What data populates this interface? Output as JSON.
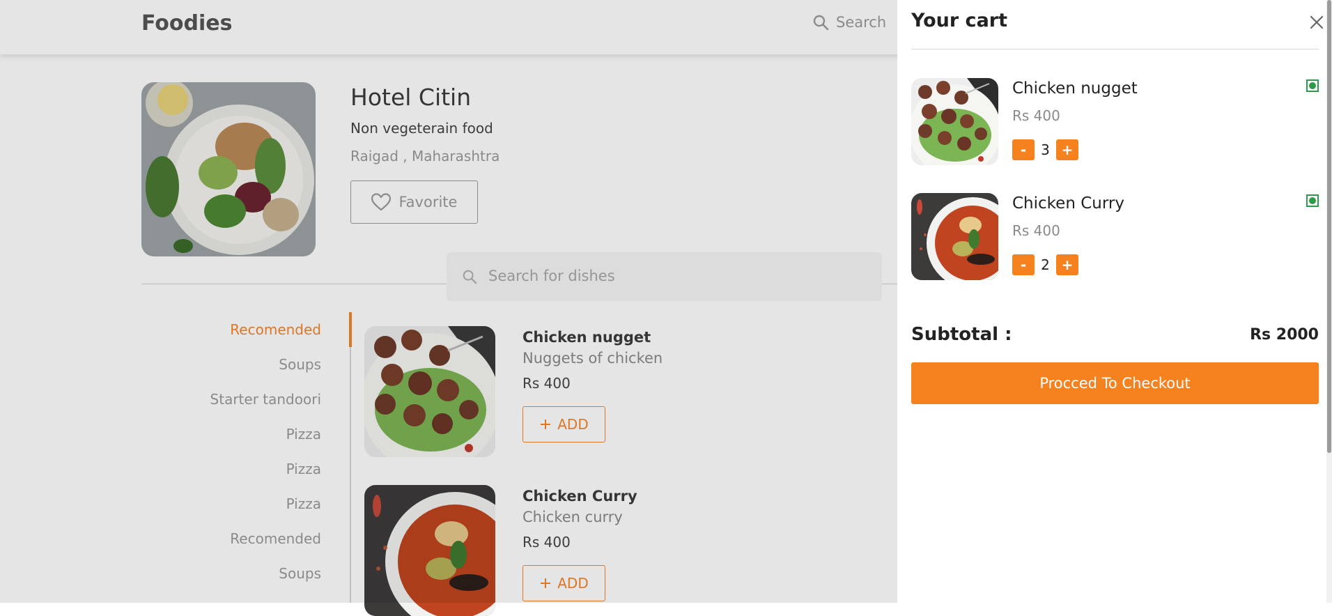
{
  "header": {
    "brand": "Foodies",
    "search_label": "Search"
  },
  "restaurant": {
    "name": "Hotel Citin",
    "type": "Non vegeterain food",
    "location": "Raigad , Maharashtra",
    "favorite_label": "Favorite"
  },
  "dish_search": {
    "placeholder": "Search for dishes"
  },
  "categories": [
    {
      "label": "Recomended",
      "active": true
    },
    {
      "label": "Soups"
    },
    {
      "label": "Starter tandoori"
    },
    {
      "label": "Pizza"
    },
    {
      "label": "Pizza"
    },
    {
      "label": "Pizza"
    },
    {
      "label": "Recomended"
    },
    {
      "label": "Soups"
    }
  ],
  "dishes": [
    {
      "name": "Chicken nugget",
      "description": "Nuggets of chicken",
      "price": "Rs 400",
      "add_label": "ADD"
    },
    {
      "name": "Chicken Curry",
      "description": "Chicken curry",
      "price": "Rs 400",
      "add_label": "ADD"
    }
  ],
  "cart": {
    "title": "Your cart",
    "items": [
      {
        "name": "Chicken nugget",
        "price": "Rs 400",
        "quantity": "3",
        "minus": "-",
        "plus": "+"
      },
      {
        "name": "Chicken Curry",
        "price": "Rs 400",
        "quantity": "2",
        "minus": "-",
        "plus": "+"
      }
    ],
    "subtotal_label": "Subtotal :",
    "subtotal_value": "Rs 2000",
    "checkout_label": "Procced To Checkout"
  },
  "colors": {
    "accent": "#f5821f",
    "veg_indicator": "#2e9a4a"
  },
  "icons": {
    "search": "search-icon",
    "heart": "heart-icon",
    "close": "close-icon",
    "plus": "plus-icon",
    "veg": "veg-indicator-icon"
  }
}
